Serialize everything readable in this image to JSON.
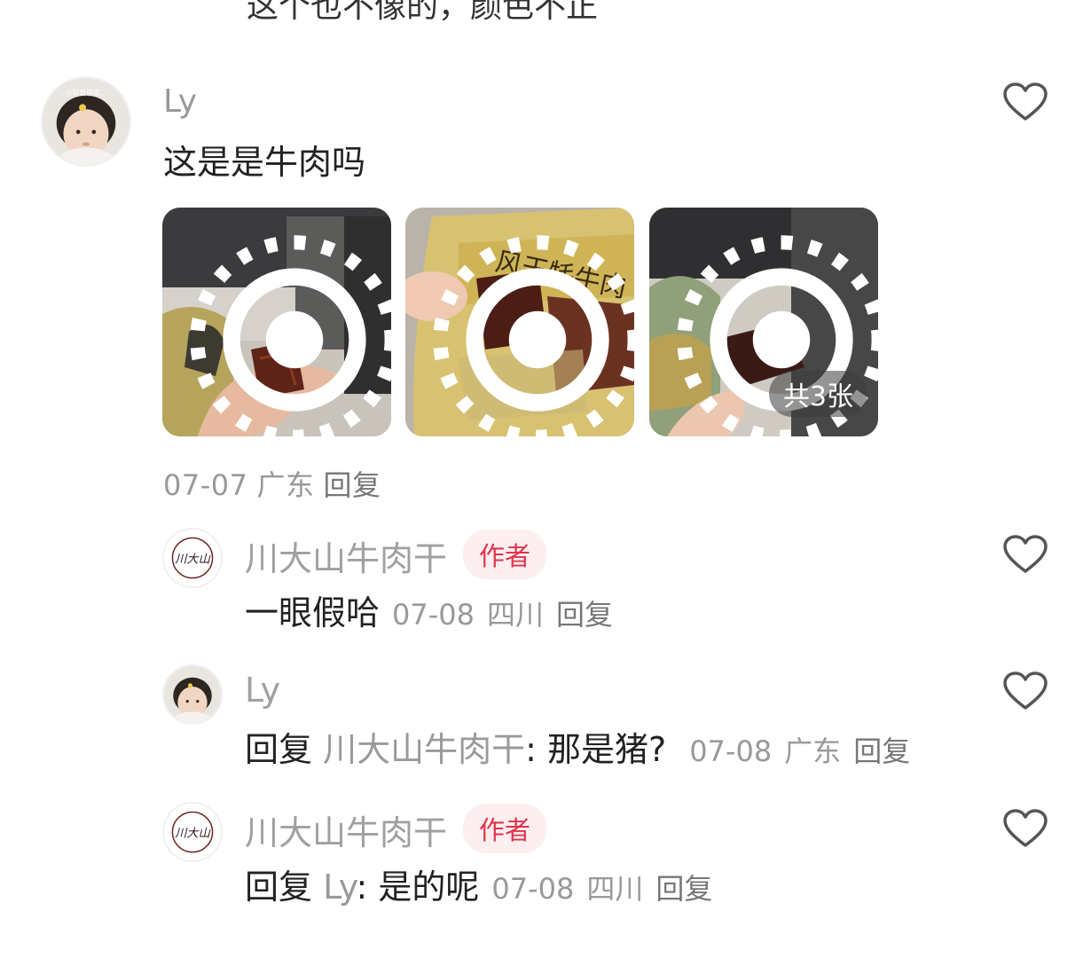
{
  "top_cut_text": "这个也不像的，颜色不正",
  "comment": {
    "username": "Ly",
    "text": "这是是牛肉吗",
    "date": "07-07",
    "location": "广东",
    "reply_label": "回复",
    "photos_count_label": "共3张",
    "avatar_caption": "小可爱语害..."
  },
  "replies": [
    {
      "username": "川大山牛肉干",
      "badge": "作者",
      "text": "一眼假哈",
      "date": "07-08",
      "location": "四川",
      "reply_label": "回复",
      "avatar_text": "川大山"
    },
    {
      "username": "Ly",
      "reply_prefix": "回复",
      "reply_target": "川大山牛肉干",
      "text": ": 那是猪?",
      "date": "07-08",
      "location": "广东",
      "reply_label": "回复"
    },
    {
      "username": "川大山牛肉干",
      "badge": "作者",
      "reply_prefix": "回复",
      "reply_target": "Ly",
      "text": ": 是的呢",
      "date": "07-08",
      "location": "四川",
      "reply_label": "回复",
      "avatar_text": "川大山"
    }
  ],
  "photo2_package_text": "风干牦牛肉",
  "colors": {
    "author_badge": "#e0334a",
    "muted": "#999999",
    "heart_stroke": "#555555"
  },
  "icons": [
    "heart-outline-icon",
    "live-photo-icon"
  ]
}
